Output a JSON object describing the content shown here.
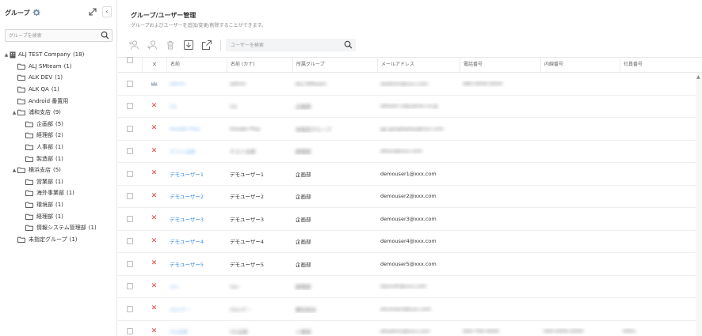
{
  "left": {
    "title": "グループ",
    "search_placeholder": "グループを検索",
    "tree": [
      {
        "label": "ALJ TEST Company",
        "count": "(18)",
        "level": 0,
        "toggle": "▲",
        "icon": "building"
      },
      {
        "label": "ALJ SMteam",
        "count": "(1)",
        "level": 1,
        "toggle": "",
        "icon": "folder"
      },
      {
        "label": "ALK DEV",
        "count": "(1)",
        "level": 1,
        "toggle": "",
        "icon": "folder"
      },
      {
        "label": "ALK QA",
        "count": "(1)",
        "level": 1,
        "toggle": "",
        "icon": "folder"
      },
      {
        "label": "Android 番置用",
        "count": "",
        "level": 1,
        "toggle": "",
        "icon": "folder"
      },
      {
        "label": "浦和支店",
        "count": "(9)",
        "level": 1,
        "toggle": "▲",
        "icon": "folder"
      },
      {
        "label": "企画部",
        "count": "(5)",
        "level": 2,
        "toggle": "",
        "icon": "folder"
      },
      {
        "label": "経理部",
        "count": "(2)",
        "level": 2,
        "toggle": "",
        "icon": "folder"
      },
      {
        "label": "人事部",
        "count": "(1)",
        "level": 2,
        "toggle": "",
        "icon": "folder"
      },
      {
        "label": "製造部",
        "count": "(1)",
        "level": 2,
        "toggle": "",
        "icon": "folder"
      },
      {
        "label": "横浜支店",
        "count": "(5)",
        "level": 1,
        "toggle": "▲",
        "icon": "folder"
      },
      {
        "label": "営業部",
        "count": "(1)",
        "level": 2,
        "toggle": "",
        "icon": "folder"
      },
      {
        "label": "海外事業部",
        "count": "(1)",
        "level": 2,
        "toggle": "",
        "icon": "folder"
      },
      {
        "label": "環境部",
        "count": "(1)",
        "level": 2,
        "toggle": "",
        "icon": "folder"
      },
      {
        "label": "経理部",
        "count": "(1)",
        "level": 2,
        "toggle": "",
        "icon": "folder"
      },
      {
        "label": "情報システム管理部",
        "count": "(1)",
        "level": 2,
        "toggle": "",
        "icon": "folder"
      },
      {
        "label": "未指定グループ",
        "count": "(1)",
        "level": 1,
        "toggle": "",
        "icon": "folder"
      }
    ],
    "icons": {
      "settings": "gear-icon",
      "expand": "expand-icon",
      "collapse": "chevron-left-icon",
      "search": "search-icon"
    }
  },
  "main": {
    "title": "グループ/ユーザー管理",
    "subtitle": "グループおよびユーザーを追加/変更/削除することができます。",
    "search_placeholder": "ユーザーを検索",
    "toolbar_icons": [
      "add-user-icon",
      "add-user-to-group-icon",
      "delete-icon",
      "download-icon",
      "export-icon"
    ],
    "columns": {
      "action": "✕",
      "name": "名前",
      "kana": "名前 (カナ)",
      "group": "所属グループ",
      "email": "メールアドレス",
      "tel": "電話番号",
      "ext": "内線番号",
      "emp": "社員番号"
    },
    "rows": [
      {
        "action": "crown",
        "name": "admin",
        "kana": "admin",
        "group": "ALJ SMteam",
        "email": "aladmin@xxx.com",
        "tel": "080-0000-0000",
        "ext": "",
        "emp": "",
        "blurred": true
      },
      {
        "action": "x",
        "name": "ﾃｽﾄ",
        "kana": "ﾃｽﾄ",
        "group": "企画部",
        "email": "alteam-1@yahoo.co.jp",
        "tel": "",
        "ext": "",
        "emp": "",
        "blurred": true
      },
      {
        "action": "x",
        "name": "Google Play",
        "kana": "Google Play",
        "group": "未指定グループ",
        "email": "gp.googleplay@xxx.com",
        "tel": "",
        "ext": "",
        "emp": "",
        "blurred": true
      },
      {
        "action": "x",
        "name": "テスト太郎",
        "kana": "テスト太郎",
        "group": "経理部",
        "email": "altaro@xxx.com",
        "tel": "",
        "ext": "",
        "emp": "",
        "blurred": true
      },
      {
        "action": "x",
        "name": "デモユーザー1",
        "kana": "デモユーザー1",
        "group": "企画部",
        "email": "demouser1@xxx.com",
        "tel": "",
        "ext": "",
        "emp": "",
        "blurred": false
      },
      {
        "action": "x",
        "name": "デモユーザー2",
        "kana": "デモユーザー2",
        "group": "企画部",
        "email": "demouser2@xxx.com",
        "tel": "",
        "ext": "",
        "emp": "",
        "blurred": false
      },
      {
        "action": "x",
        "name": "デモユーザー3",
        "kana": "デモユーザー3",
        "group": "企画部",
        "email": "demouser3@xxx.com",
        "tel": "",
        "ext": "",
        "emp": "",
        "blurred": false
      },
      {
        "action": "x",
        "name": "デモユーザー4",
        "kana": "デモユーザー4",
        "group": "企画部",
        "email": "demouser4@xxx.com",
        "tel": "",
        "ext": "",
        "emp": "",
        "blurred": false
      },
      {
        "action": "x",
        "name": "デモユーザー5",
        "kana": "デモユーザー5",
        "group": "企画部",
        "email": "demouser5@xxx.com",
        "tel": "",
        "ext": "",
        "emp": "",
        "blurred": false
      },
      {
        "action": "x",
        "name": "ﾃｽﾄｰ",
        "kana": "ﾃｽﾄｰ",
        "group": "経理部",
        "email": "alyouth@xxx.com",
        "tel": "",
        "ext": "",
        "emp": "",
        "blurred": true
      },
      {
        "action": "x",
        "name": "ﾃｽﾄﾕｰｻﾞｰ",
        "kana": "ﾃｽﾄﾕｰｻﾞｰ",
        "group": "横浜支店",
        "email": "alcontact@xxx.com",
        "tel": "",
        "ext": "",
        "emp": "",
        "blurred": true
      },
      {
        "action": "x",
        "name": "ﾃｽﾄ太郎",
        "kana": "ﾃｽﾄ太郎",
        "group": "人事部",
        "email": "altadmin@xxx.com",
        "tel": "000-700-0000",
        "ext": "000-0000-0000",
        "emp": "0001",
        "blurred": true
      }
    ],
    "colors": {
      "link": "#3a8ee6",
      "delete": "#e03c3c",
      "crown": "#b0b8c8"
    }
  }
}
